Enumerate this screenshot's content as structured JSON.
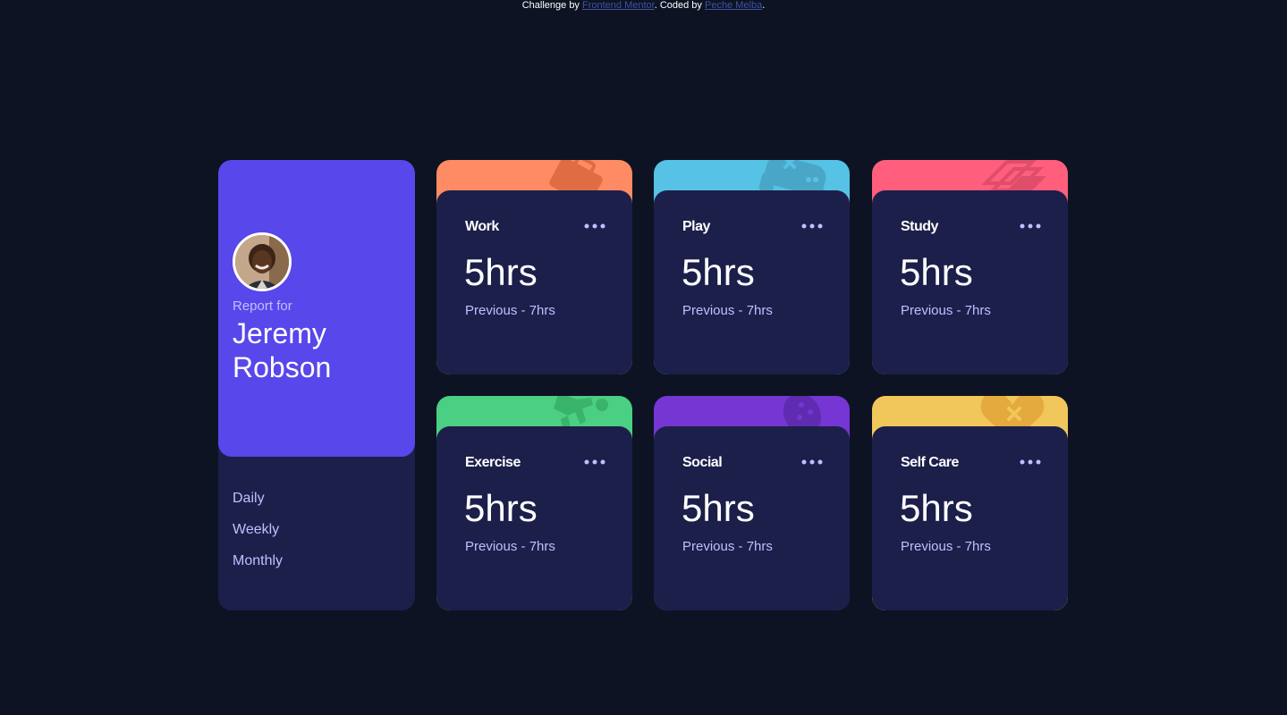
{
  "attribution": {
    "prefix": "Challenge by ",
    "link1": "Frontend Mentor",
    "middle": ". Coded by ",
    "link2": "Peche Melba",
    "suffix": "."
  },
  "profile": {
    "report_label": "Report for",
    "first_name": "Jeremy",
    "last_name": "Robson",
    "periods": [
      "Daily",
      "Weekly",
      "Monthly"
    ]
  },
  "colors": {
    "background": "#0d1323",
    "card": "#1c1f4a",
    "accent": "#5847eb",
    "muted_text": "#bdc1ff"
  },
  "cards": [
    {
      "title": "Work",
      "current": "5hrs",
      "previous": "Previous - 7hrs",
      "color": "#ff8b64",
      "icon": "briefcase-icon"
    },
    {
      "title": "Play",
      "current": "5hrs",
      "previous": "Previous - 7hrs",
      "color": "#55c2e6",
      "icon": "gamepad-icon"
    },
    {
      "title": "Study",
      "current": "5hrs",
      "previous": "Previous - 7hrs",
      "color": "#ff5e7d",
      "icon": "books-icon"
    },
    {
      "title": "Exercise",
      "current": "5hrs",
      "previous": "Previous - 7hrs",
      "color": "#4bcf82",
      "icon": "runner-icon"
    },
    {
      "title": "Social",
      "current": "5hrs",
      "previous": "Previous - 7hrs",
      "color": "#7536d3",
      "icon": "balloon-icon"
    },
    {
      "title": "Self Care",
      "current": "5hrs",
      "previous": "Previous - 7hrs",
      "color": "#f1c65b",
      "icon": "heart-icon"
    }
  ]
}
